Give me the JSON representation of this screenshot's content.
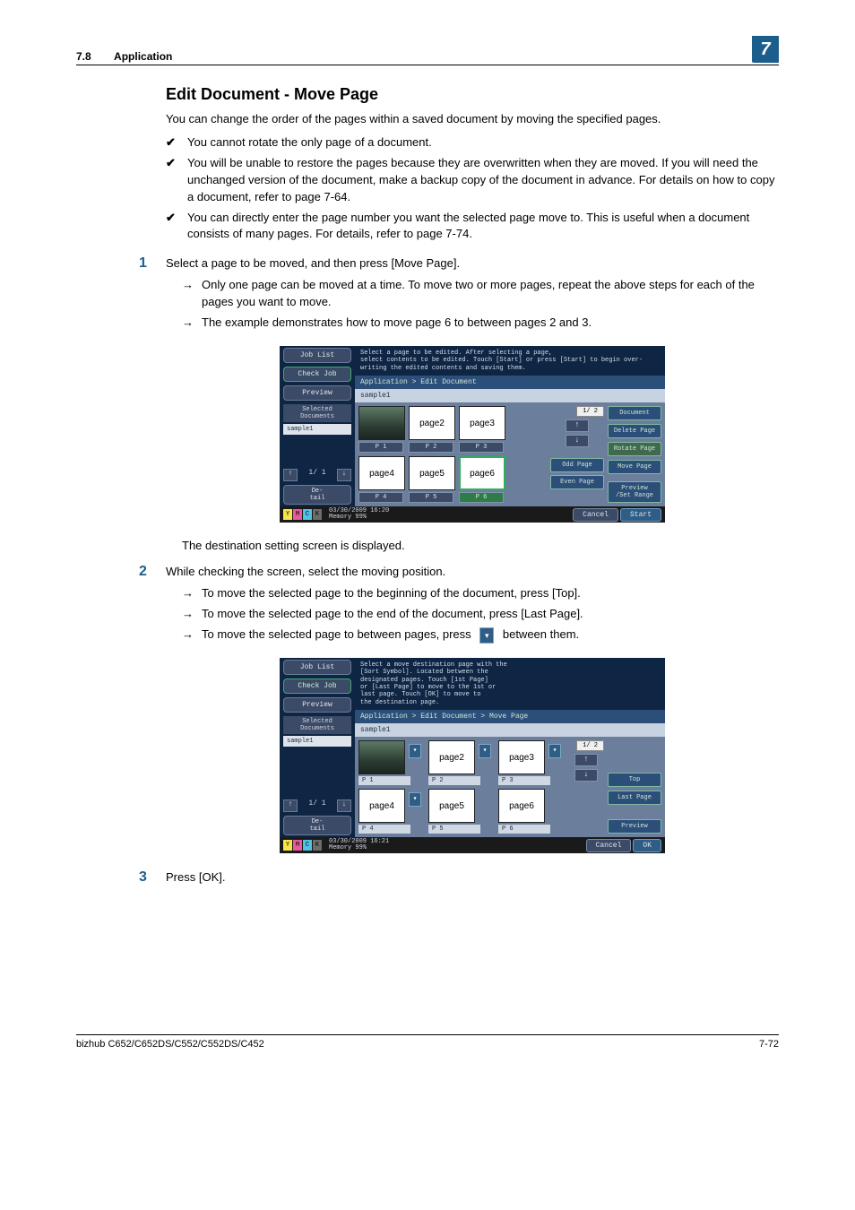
{
  "header": {
    "section_number": "7.8",
    "section_title": "Application",
    "chapter_number": "7"
  },
  "heading": "Edit Document - Move Page",
  "intro": "You can change the order of the pages within a saved document by moving the specified pages.",
  "bullets": [
    "You cannot rotate the only page of a document.",
    "You will be unable to restore the pages because they are overwritten when they are moved. If you will need the unchanged version of the document, make a backup copy of the document in advance. For details on how to copy a document, refer to page 7-64.",
    "You can directly enter the page number you want the selected page move to. This is useful when a document consists of many pages. For details, refer to page 7-74."
  ],
  "step1": {
    "num": "1",
    "text": "Select a page to be moved, and then press [Move Page].",
    "subs": [
      "Only one page can be moved at a time. To move two or more pages, repeat the above steps for each of the pages you want to move.",
      "The example demonstrates how to move page 6 to between pages 2 and 3."
    ]
  },
  "screen1": {
    "left": {
      "job_list": "Job List",
      "check_job": "Check Job",
      "preview": "Preview",
      "sel_docs": "Selected Documents",
      "sample": "sample1",
      "nav_count": "1/  1",
      "detail": "De-\ntail"
    },
    "instruction": "Select a page to be edited. After selecting a page,\nselect contents to be edited. Touch [Start] or press [Start] to begin over-\nwriting the edited contents and saving them.",
    "crumb": "Application > Edit Document",
    "doc": "sample1",
    "thumbs": [
      "",
      "page2",
      "page3",
      "page4",
      "page5",
      "page6"
    ],
    "thumb_caps": [
      "P   1",
      "P   2",
      "P   3",
      "P   4",
      "P   5",
      "P   6"
    ],
    "page_ind": "1/  2",
    "odd": "Odd Page",
    "even": "Even Page",
    "side": {
      "document": "Document",
      "delete": "Delete Page",
      "rotate": "Rotate Page",
      "move": "Move Page",
      "preview": "Preview\n/Set Range"
    },
    "footer": {
      "datetime": "03/30/2009   16:20",
      "memory": "Memory       99%",
      "cancel": "Cancel",
      "start": "Start"
    }
  },
  "after_screen1": "The destination setting screen is displayed.",
  "step2": {
    "num": "2",
    "text": "While checking the screen, select the moving position.",
    "subs": [
      "To move the selected page to the beginning of the document, press [Top].",
      "To move the selected page to the end of the document, press [Last Page].",
      "To move the selected page to between pages, press ",
      " between them."
    ]
  },
  "screen2": {
    "instruction": "Select a move destination page with the\n[Sort Symbol]. Located between the\ndesignated pages. Touch [1st Page]\nor [Last Page] to move to the 1st or\nlast page. Touch [OK] to move to\nthe destination page.",
    "crumb": "Application > Edit Document > Move Page",
    "side": {
      "top": "Top",
      "last": "Last Page",
      "preview": "Preview"
    },
    "footer": {
      "datetime": "03/30/2009   16:21",
      "memory": "Memory       99%",
      "cancel": "Cancel",
      "ok": "OK"
    }
  },
  "step3": {
    "num": "3",
    "text": "Press [OK]."
  },
  "footer": {
    "left": "bizhub C652/C652DS/C552/C552DS/C452",
    "right": "7-72"
  }
}
